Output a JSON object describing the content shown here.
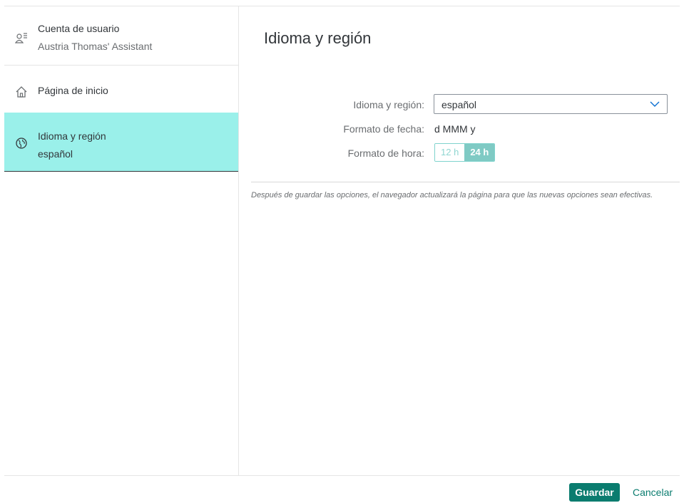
{
  "sidebar": {
    "items": [
      {
        "key": "user",
        "icon": "user-account-icon",
        "title": "Cuenta de usuario",
        "description": "Austria Thomas' Assistant"
      },
      {
        "key": "home",
        "icon": "home-icon",
        "title": "Página de inicio",
        "description": ""
      },
      {
        "key": "lang",
        "icon": "globe-icon",
        "title": "Idioma y región",
        "description": "español",
        "selected": true
      }
    ]
  },
  "main": {
    "title": "Idioma y región",
    "language": {
      "label": "Idioma y región:",
      "value": "español"
    },
    "date_format": {
      "label": "Formato de fecha:",
      "value": "d MMM y"
    },
    "time_format": {
      "label": "Formato de hora:",
      "options": [
        "12 h",
        "24 h"
      ],
      "selected": "24 h"
    },
    "note": "Después de guardar las opciones, el navegador actualizará la página para que las nuevas opciones sean efectivas."
  },
  "footer": {
    "save_label": "Guardar",
    "cancel_label": "Cancelar"
  },
  "colors": {
    "accent": "#0a7c6f",
    "selected_bg": "#9af0ea",
    "toggle_active": "#7fcac4"
  }
}
